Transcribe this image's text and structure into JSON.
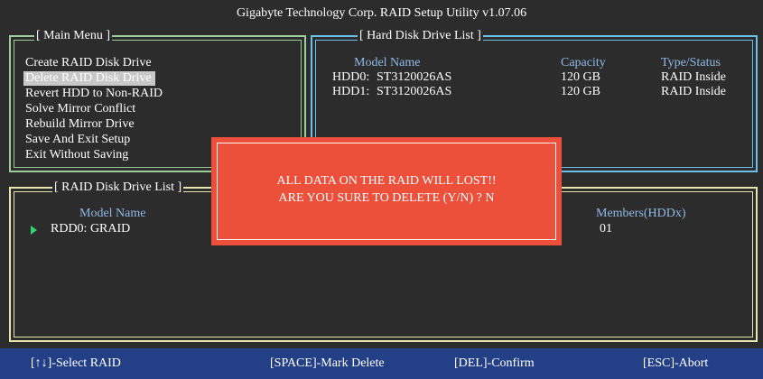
{
  "window": {
    "title": "Gigabyte Technology Corp.  RAID Setup Utility  v1.07.06"
  },
  "main_menu": {
    "title": "[ Main Menu ]",
    "items": [
      "Create RAID Disk Drive",
      "Delete RAID Disk Drive",
      "Revert HDD to Non-RAID",
      "Solve Mirror Conflict",
      "Rebuild Mirror Drive",
      "Save And Exit Setup",
      "Exit Without Saving"
    ],
    "selected_index": 1
  },
  "hdd_list": {
    "title": "[ Hard Disk Drive List ]",
    "headers": {
      "model": "Model Name",
      "capacity": "Capacity",
      "type": "Type/Status"
    },
    "rows": [
      {
        "id": "HDD0:",
        "model": "ST3120026AS",
        "capacity": "120 GB",
        "type": "RAID Inside"
      },
      {
        "id": "HDD1:",
        "model": "ST3120026AS",
        "capacity": "120 GB",
        "type": "RAID Inside"
      }
    ]
  },
  "raid_list": {
    "title": "[ RAID Disk Drive List ]",
    "headers": {
      "model": "Model Name",
      "members": "Members(HDDx)"
    },
    "rows": [
      {
        "name": "RDD0: GRAID",
        "members": "01"
      }
    ]
  },
  "dialog": {
    "line1": "ALL DATA ON THE RAID WILL LOST!!",
    "line2": "ARE YOU SURE TO DELETE (Y/N) ? N"
  },
  "footer": {
    "select": "[↑↓]-Select RAID",
    "mark": "[SPACE]-Mark Delete",
    "confirm": "[DEL]-Confirm",
    "abort": "[ESC]-Abort"
  },
  "colors": {
    "background": "#2c2c2c",
    "main_menu_border": "#9ccc9a",
    "hdd_border": "#6cc0e8",
    "raid_border": "#e9e3b0",
    "dialog_bg": "#ec4f3a",
    "footer_bg": "#233f86",
    "header_text": "#8fb9e6",
    "selection_arrow": "#33d36a"
  }
}
